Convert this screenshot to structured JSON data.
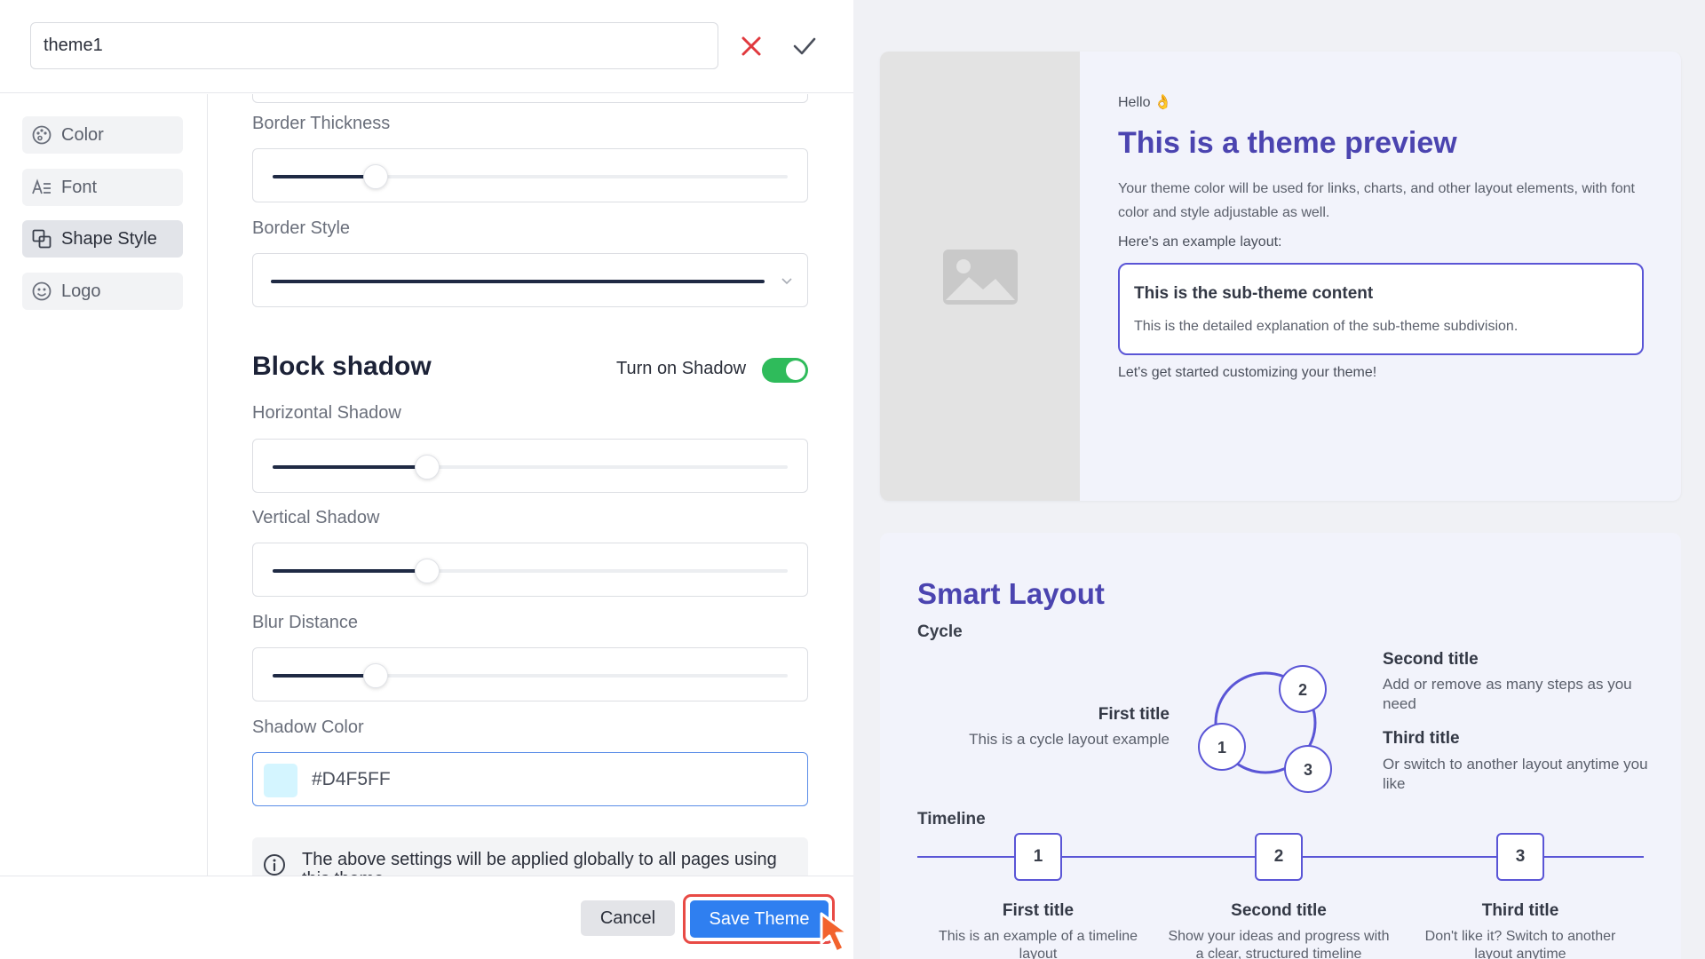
{
  "header": {
    "theme_name": "theme1"
  },
  "sidebar": {
    "items": [
      {
        "label": "Color",
        "icon": "palette-icon"
      },
      {
        "label": "Font",
        "icon": "text-font-icon"
      },
      {
        "label": "Shape Style",
        "icon": "shapes-icon",
        "active": true
      },
      {
        "label": "Logo",
        "icon": "face-logo-icon"
      }
    ]
  },
  "settings": {
    "border_thickness": {
      "label": "Border Thickness",
      "value": 0.2
    },
    "border_style": {
      "label": "Border Style",
      "selected": "solid"
    },
    "block_shadow": {
      "title": "Block shadow",
      "toggle_label": "Turn on Shadow",
      "enabled": true
    },
    "horizontal_shadow": {
      "label": "Horizontal Shadow",
      "value": 0.3
    },
    "vertical_shadow": {
      "label": "Vertical Shadow",
      "value": 0.3
    },
    "blur_distance": {
      "label": "Blur Distance",
      "value": 0.2
    },
    "shadow_color": {
      "label": "Shadow Color",
      "value": "#D4F5FF"
    },
    "info_text": "The above settings will be applied globally to all pages using this theme."
  },
  "footer": {
    "cancel_label": "Cancel",
    "save_label": "Save Theme"
  },
  "preview": {
    "hello": "Hello 👌",
    "title": "This is a theme preview",
    "description": "Your theme color will be used for links, charts, and other layout elements, with font color and style adjustable as well.",
    "example_label": "Here's an example layout:",
    "sub_title": "This is the sub-theme content",
    "sub_desc": "This is the detailed explanation of the sub-theme subdivision.",
    "start_text": "Let's get started customizing your theme!"
  },
  "smart_layout": {
    "title": "Smart Layout",
    "cycle_label": "Cycle",
    "cycle": [
      {
        "num": "1",
        "title": "First title",
        "desc": "This is a cycle layout example"
      },
      {
        "num": "2",
        "title": "Second title",
        "desc": "Add or remove as many steps as you need"
      },
      {
        "num": "3",
        "title": "Third title",
        "desc": "Or switch to another layout anytime you like"
      }
    ],
    "timeline_label": "Timeline",
    "timeline": [
      {
        "num": "1",
        "title": "First title",
        "desc": "This is an example of a timeline layout"
      },
      {
        "num": "2",
        "title": "Second title",
        "desc": "Show your ideas and progress with a clear, structured timeline"
      },
      {
        "num": "3",
        "title": "Third title",
        "desc": "Don't like it? Switch to another layout anytime"
      }
    ]
  },
  "colors": {
    "accent": "#4b44b0",
    "save_button": "#2f7ff0",
    "toggle_on": "#2fbb5b",
    "cancel_x": "#e0393e",
    "highlight": "#e84a45"
  }
}
